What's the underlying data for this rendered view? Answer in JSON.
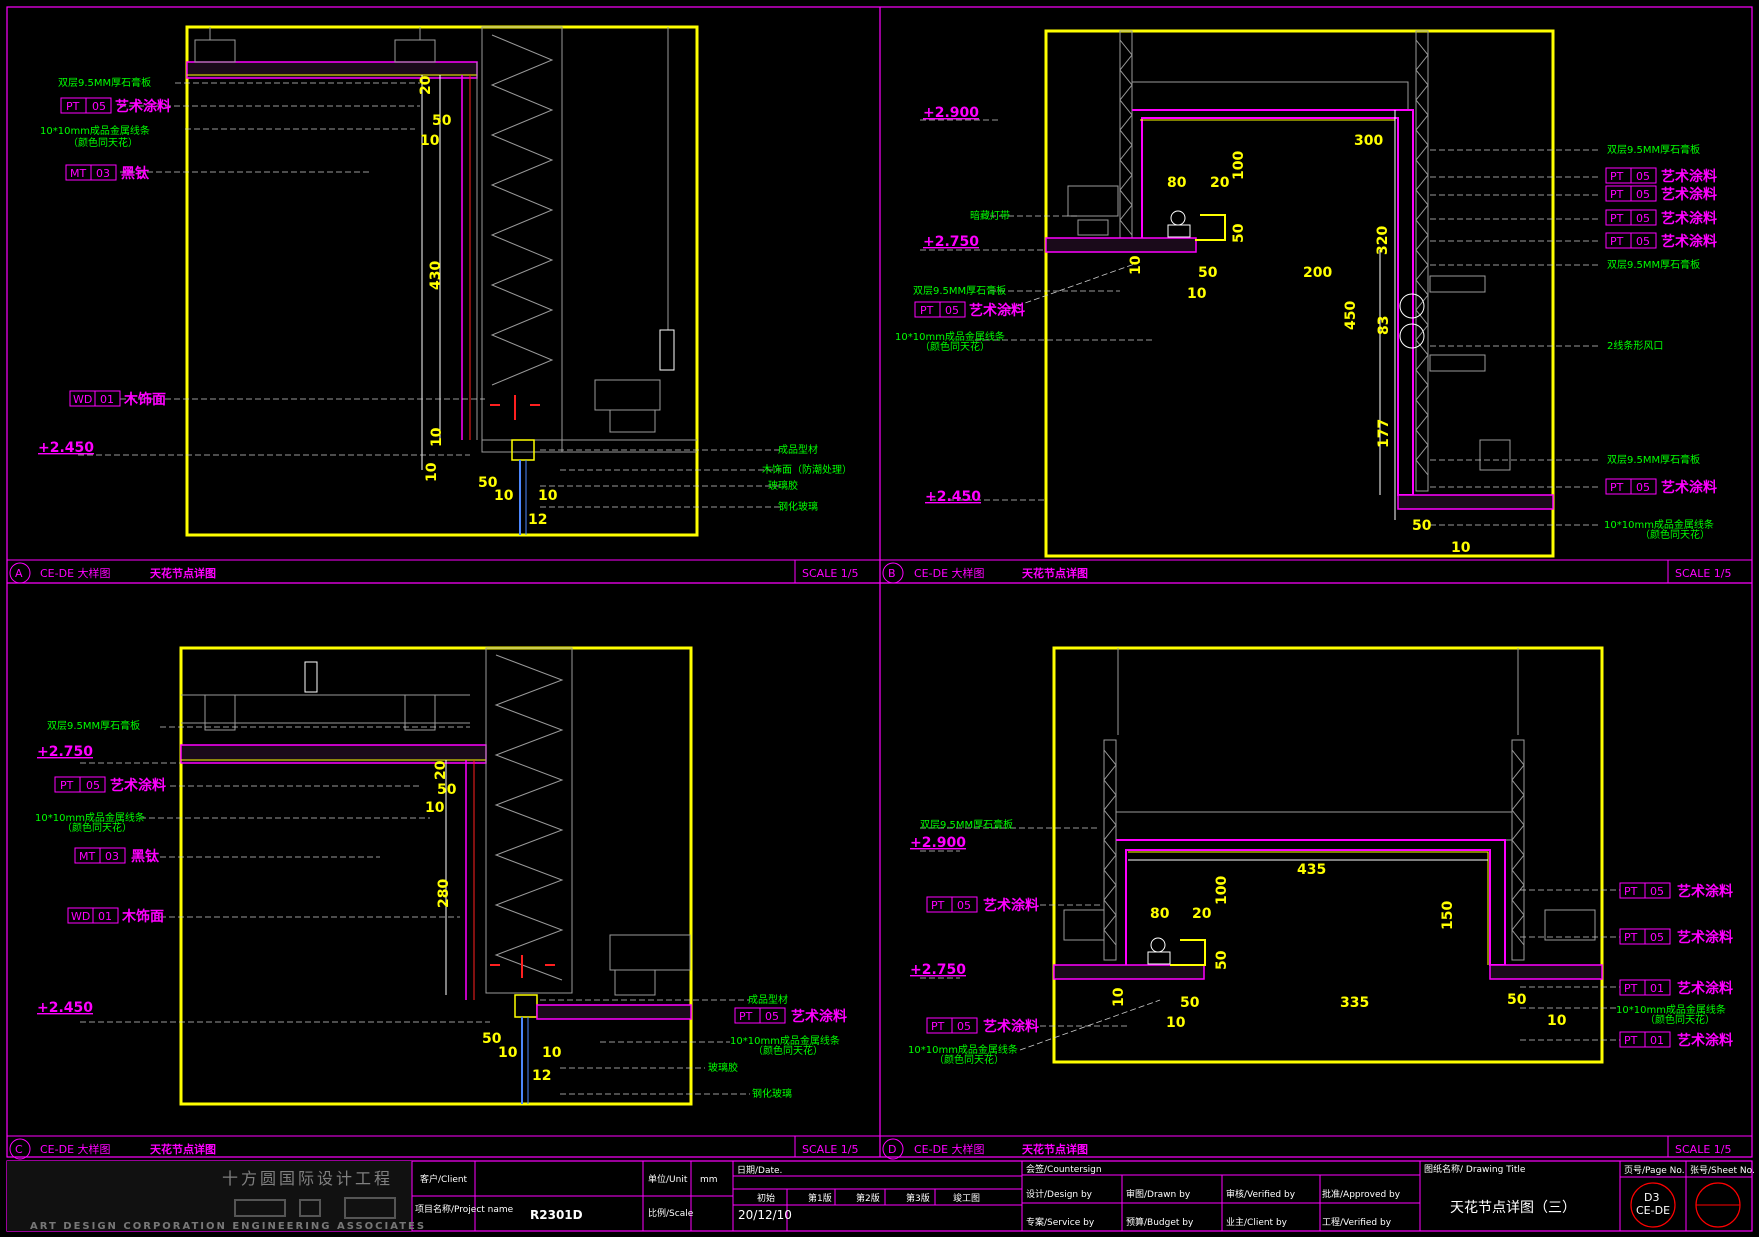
{
  "panels": {
    "A": {
      "letter": "A",
      "ref": "CE-DE 大样图",
      "title": "天花节点详图",
      "scale": "SCALE 1/5",
      "elevations": [
        "+2.450"
      ],
      "dims": [
        "20",
        "50",
        "10",
        "430",
        "10",
        "10",
        "50",
        "10",
        "10",
        "12"
      ],
      "notes_left": [
        "双层9.5MM厚石膏板",
        "10*10mm成品金属线条",
        "（颜色同天花）"
      ],
      "notes_right": [
        "成品型材",
        "木饰面（防潮处理）",
        "玻璃胶",
        "钢化玻璃"
      ],
      "tags": [
        {
          "code": "PT",
          "num": "05",
          "label": "艺术涂料"
        },
        {
          "code": "MT",
          "num": "03",
          "label": "黑钛"
        },
        {
          "code": "WD",
          "num": "01",
          "label": "木饰面"
        }
      ]
    },
    "B": {
      "letter": "B",
      "ref": "CE-DE 大样图",
      "title": "天花节点详图",
      "scale": "SCALE 1/5",
      "elevations": [
        "+2.900",
        "+2.750",
        "+2.450"
      ],
      "dims": [
        "300",
        "80",
        "20",
        "100",
        "50",
        "10",
        "50",
        "200",
        "10",
        "320",
        "450",
        "83",
        "177",
        "50",
        "10"
      ],
      "notes_left": [
        "暗藏灯带",
        "双层9.5MM厚石膏板",
        "10*10mm成品金属线条",
        "（颜色同天花）"
      ],
      "notes_right": [
        "双层9.5MM厚石膏板",
        "双层9.5MM厚石膏板",
        "2线条形风口",
        "双层9.5MM厚石膏板",
        "10*10mm成品金属线条",
        "（颜色同天花）"
      ],
      "tags_left": [
        {
          "code": "PT",
          "num": "05",
          "label": "艺术涂料"
        }
      ],
      "tags_right": [
        {
          "code": "PT",
          "num": "05",
          "label": "艺术涂料"
        },
        {
          "code": "PT",
          "num": "05",
          "label": "艺术涂料"
        },
        {
          "code": "PT",
          "num": "05",
          "label": "艺术涂料"
        },
        {
          "code": "PT",
          "num": "05",
          "label": "艺术涂料"
        },
        {
          "code": "PT",
          "num": "05",
          "label": "艺术涂料"
        }
      ]
    },
    "C": {
      "letter": "C",
      "ref": "CE-DE 大样图",
      "title": "天花节点详图",
      "scale": "SCALE 1/5",
      "elevations": [
        "+2.750",
        "+2.450"
      ],
      "dims": [
        "20",
        "50",
        "10",
        "280",
        "50",
        "10",
        "10",
        "12"
      ],
      "notes_left": [
        "双层9.5MM厚石膏板",
        "10*10mm成品金属线条",
        "（颜色同天花）"
      ],
      "notes_right": [
        "成品型材",
        "10*10mm成品金属线条",
        "（颜色同天花）",
        "玻璃胶",
        "钢化玻璃"
      ],
      "tags": [
        {
          "code": "PT",
          "num": "05",
          "label": "艺术涂料"
        },
        {
          "code": "MT",
          "num": "03",
          "label": "黑钛"
        },
        {
          "code": "WD",
          "num": "01",
          "label": "木饰面"
        }
      ],
      "tag_right": {
        "code": "PT",
        "num": "05",
        "label": "艺术涂料"
      }
    },
    "D": {
      "letter": "D",
      "ref": "CE-DE 大样图",
      "title": "天花节点详图",
      "scale": "SCALE 1/5",
      "elevations": [
        "+2.900",
        "+2.750"
      ],
      "dims": [
        "435",
        "80",
        "20",
        "100",
        "150",
        "50",
        "10",
        "50",
        "10",
        "335",
        "50",
        "10"
      ],
      "notes_left": [
        "双层9.5MM厚石膏板",
        "10*10mm成品金属线条",
        "（颜色同天花）"
      ],
      "notes_right": [
        "10*10mm成品金属线条",
        "（颜色同天花）"
      ],
      "tags_left": [
        {
          "code": "PT",
          "num": "05",
          "label": "艺术涂料"
        },
        {
          "code": "PT",
          "num": "05",
          "label": "艺术涂料"
        }
      ],
      "tags_right": [
        {
          "code": "PT",
          "num": "05",
          "label": "艺术涂料"
        },
        {
          "code": "PT",
          "num": "05",
          "label": "艺术涂料"
        },
        {
          "code": "PT",
          "num": "01",
          "label": "艺术涂料"
        },
        {
          "code": "PT",
          "num": "01",
          "label": "艺术涂料"
        }
      ]
    }
  },
  "titleblock": {
    "company_cn": "十方圆国际设计工程",
    "company_en": "ART DESIGN CORPORATION ENGINEERING ASSOCIATES",
    "client_label": "客户/Client",
    "project_label": "项目名称/Project name",
    "project_value": "R2301D",
    "unit_label": "单位/Unit",
    "unit_value": "mm",
    "scale_label": "比例/Scale",
    "date_label": "日期/Date.",
    "phases": [
      "初始",
      "第1版",
      "第2版",
      "第3版",
      "竣工图"
    ],
    "date_value": "20/12/10",
    "countersign": "会签/Countersign",
    "roles": [
      "设计/Design by",
      "审图/Drawn by",
      "审核/Verified by",
      "批准/Approved by",
      "专案/Service by",
      "预算/Budget by",
      "业主/Client by",
      "工程/Verified by"
    ],
    "drawing_title_label": "图纸名称/    Drawing Title",
    "drawing_title": "天花节点详图（三）",
    "page_label": "页号/Page No.",
    "page_value_1": "D3",
    "page_value_2": "CE-DE",
    "sheet_label": "张号/Sheet No."
  },
  "colors": {
    "frame": "#ffff00",
    "annotation": "#ff00ff",
    "note": "#00ff00",
    "linework": "#9a9a9a"
  }
}
